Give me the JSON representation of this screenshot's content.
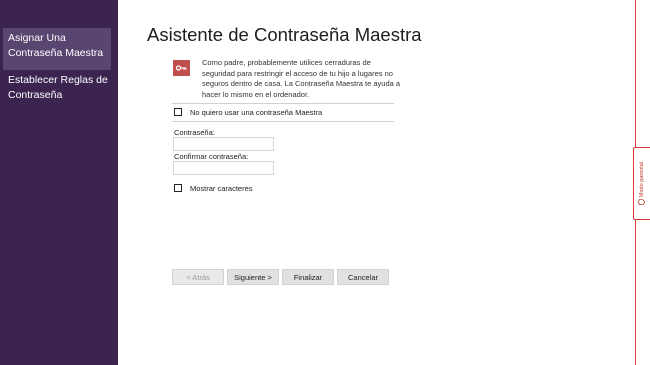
{
  "sidebar": {
    "steps": [
      {
        "label": "Asignar Una Contraseña Maestra"
      },
      {
        "label": "Establecer Reglas de Contraseña"
      }
    ]
  },
  "main": {
    "title": "Asistente de Contraseña Maestra",
    "description": "Como padre, probablemente utilices cerraduras de seguridad para restringir el acceso de tu hijo a lugares no seguros dentro de casa.  La Contraseña Maestra te ayuda a hacer lo mismo en el ordenador.",
    "no_password_label": "No quiero usar una contraseña Maestra",
    "password_label": "Contraseña:",
    "password_value": "",
    "confirm_label": "Confirmar contraseña:",
    "confirm_value": "",
    "show_chars_label": "Mostrar caracteres"
  },
  "buttons": {
    "back": "< Atrás",
    "next": "Siguiente >",
    "finish": "Finalizar",
    "cancel": "Cancelar"
  },
  "side_tab": {
    "label": "Modo parental",
    "icon": "shield-icon"
  },
  "colors": {
    "sidebar": "#3b2550",
    "sidebar_active": "#584671",
    "accent": "#c0504d",
    "edge": "#e13c3c"
  }
}
